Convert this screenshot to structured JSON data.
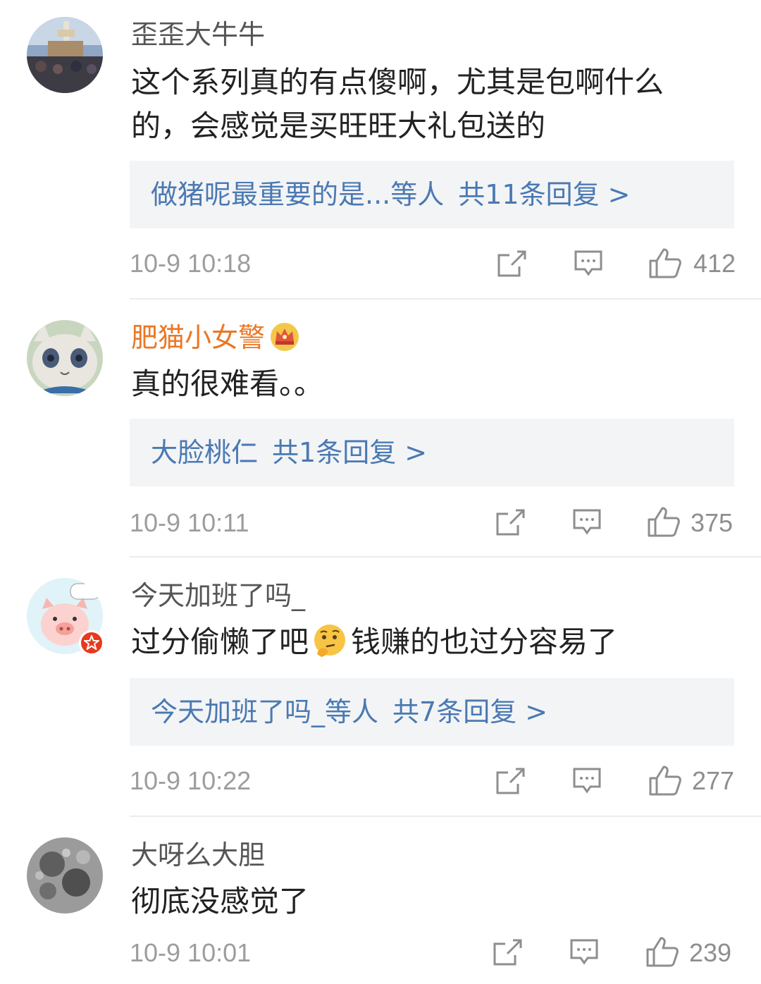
{
  "comments": [
    {
      "username": "歪歪大牛牛",
      "text": "这个系列真的有点傻啊，尤其是包啊什么的，会感觉是买旺旺大礼包送的",
      "reply_who": "做猪呢最重要的是...等人",
      "reply_count": "共11条回复 >",
      "time": "10-9 10:18",
      "likes": "412",
      "avatar_icon": "crowd-photo-avatar"
    },
    {
      "username": "肥猫小女警",
      "badge_icon": "crown-icon",
      "text": "真的很难看。。",
      "reply_who": "大脸桃仁",
      "reply_count": "共1条回复 >",
      "time": "10-9 10:11",
      "likes": "375",
      "avatar_icon": "cartoon-cat-avatar"
    },
    {
      "username": "今天加班了吗_",
      "text_before": "过分偷懒了吧",
      "text_emoji": "thinking-face-emoji",
      "text_after": "钱赚的也过分容易了",
      "reply_who": "今天加班了吗_等人",
      "reply_count": "共7条回复 >",
      "time": "10-9 10:22",
      "likes": "277",
      "avatar_icon": "cartoon-pig-avatar",
      "avatar_badge": "verified-star-badge"
    },
    {
      "username": "大呀么大胆",
      "text": "彻底没感觉了",
      "time": "10-9 10:01",
      "likes": "239",
      "avatar_icon": "moon-photo-avatar"
    }
  ],
  "colors": {
    "username": "#555555",
    "vip_username": "#ec7723",
    "reply_link": "#4a79b2",
    "reply_bg": "#f3f4f6",
    "meta": "#9d9d9d"
  }
}
